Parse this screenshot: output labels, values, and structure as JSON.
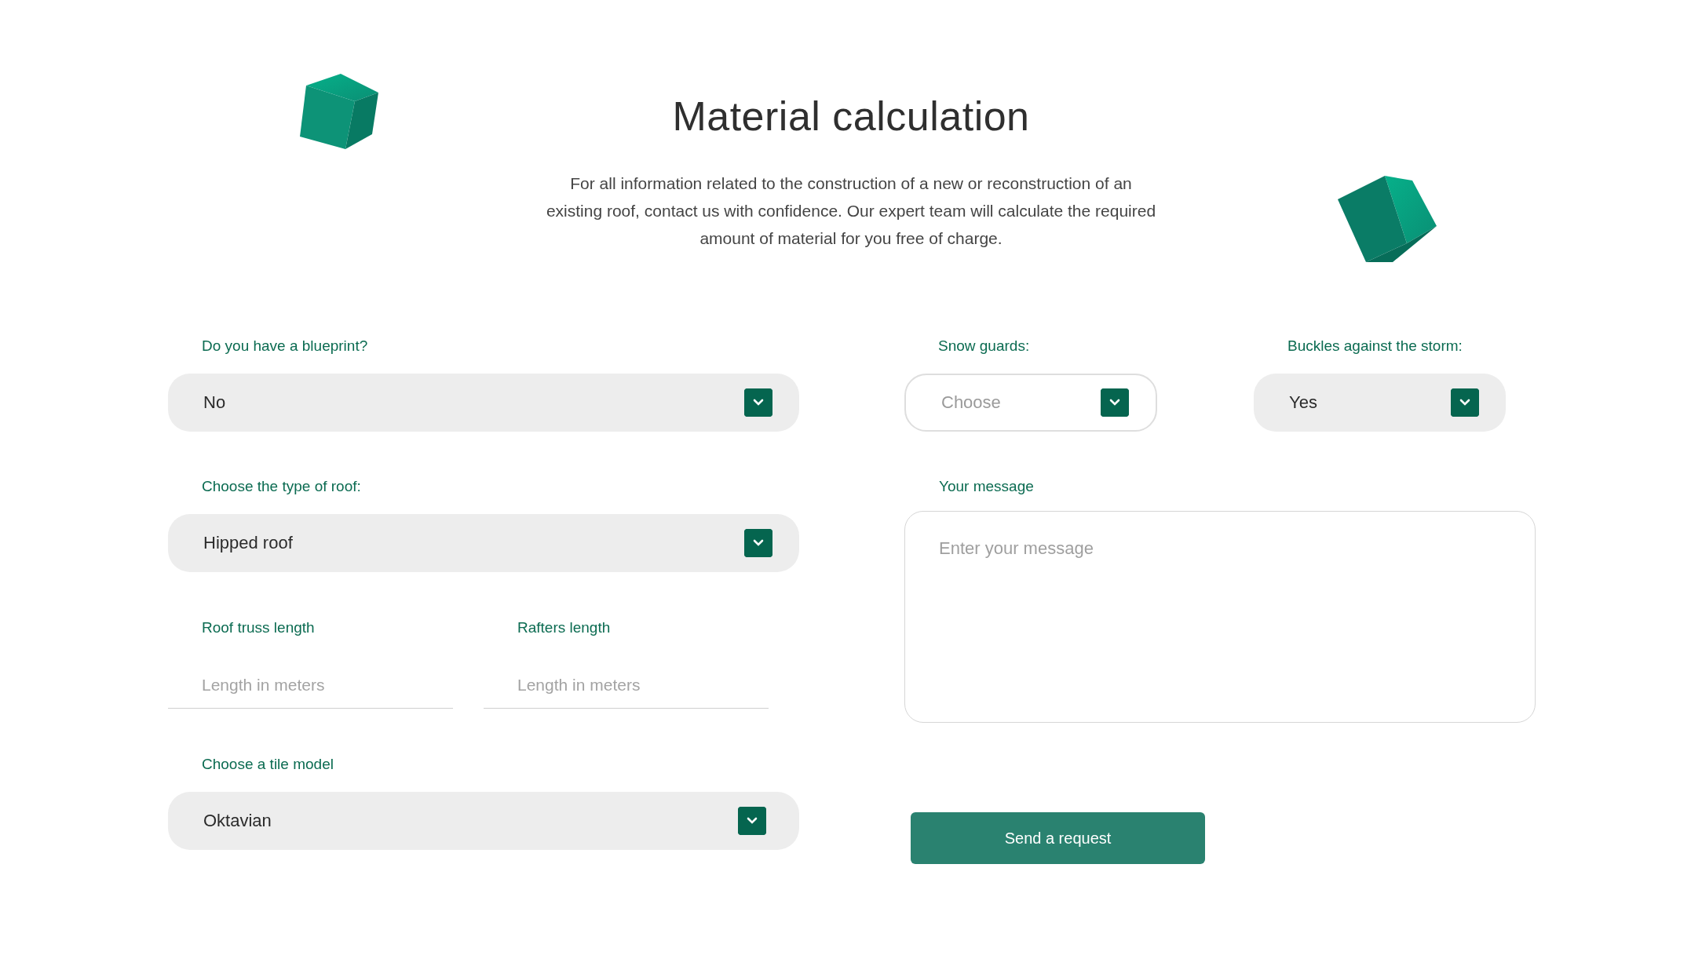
{
  "header": {
    "title": "Material calculation",
    "description": "For all information related to the construction of a new or reconstruction of an existing roof, contact us with confidence. Our expert team will calculate the required amount of material for you free of charge."
  },
  "blueprint_select": {
    "label": "Do you have a blueprint?",
    "value": "No"
  },
  "roof_type_select": {
    "label": "Choose the type of roof:",
    "value": "Hipped roof"
  },
  "roof_truss_length": {
    "label": "Roof truss length",
    "placeholder": "Length in meters"
  },
  "rafters_length": {
    "label": "Rafters length",
    "placeholder": "Length in meters"
  },
  "tile_model_select": {
    "label": "Choose a tile model",
    "value": "Oktavian"
  },
  "snow_guards_select": {
    "label": "Snow guards:",
    "placeholder": "Choose"
  },
  "storm_buckles_select": {
    "label": "Buckles against the storm:",
    "value": "Yes"
  },
  "message": {
    "label": "Your message",
    "placeholder": "Enter your message"
  },
  "submit_button": {
    "label": "Send a request"
  }
}
